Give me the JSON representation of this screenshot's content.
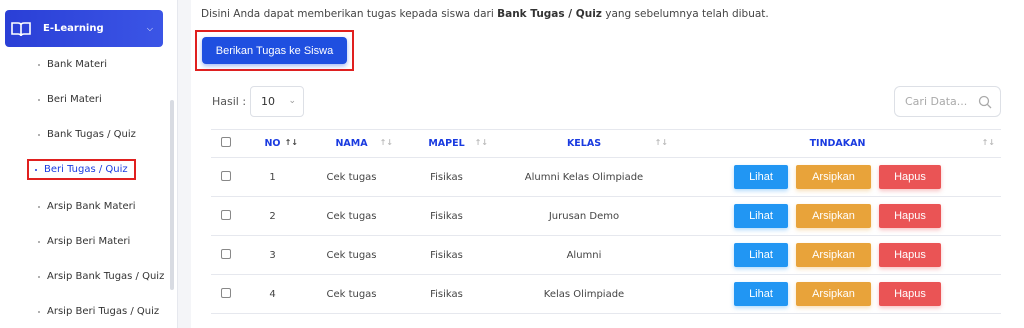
{
  "sidebar": {
    "menu": {
      "label": "E-Learning"
    },
    "items": [
      {
        "label": "Bank Materi"
      },
      {
        "label": "Beri Materi"
      },
      {
        "label": "Bank Tugas / Quiz"
      },
      {
        "label": "Beri Tugas / Quiz",
        "active": true
      },
      {
        "label": "Arsip Bank Materi"
      },
      {
        "label": "Arsip Beri Materi"
      },
      {
        "label": "Arsip Bank Tugas / Quiz"
      },
      {
        "label": "Arsip Beri Tugas / Quiz"
      }
    ]
  },
  "main": {
    "description_pre": "Disini Anda dapat memberikan tugas kepada siswa dari ",
    "description_bold": "Bank Tugas / Quiz",
    "description_post": " yang sebelumnya telah dibuat.",
    "give_button": "Berikan Tugas ke Siswa",
    "hasil_label": "Hasil :",
    "page_size": "10",
    "search_placeholder": "Cari Data..."
  },
  "table": {
    "headers": {
      "no": "NO",
      "nama": "NAMA",
      "mapel": "MAPEL",
      "kelas": "KELAS",
      "tindakan": "TINDAKAN"
    },
    "rows": [
      {
        "no": "1",
        "nama": "Cek tugas",
        "mapel": "Fisikas",
        "kelas": "Alumni Kelas Olimpiade"
      },
      {
        "no": "2",
        "nama": "Cek tugas",
        "mapel": "Fisikas",
        "kelas": "Jurusan Demo"
      },
      {
        "no": "3",
        "nama": "Cek tugas",
        "mapel": "Fisikas",
        "kelas": "Alumni"
      },
      {
        "no": "4",
        "nama": "Cek tugas",
        "mapel": "Fisikas",
        "kelas": "Kelas Olimpiade"
      }
    ],
    "actions": {
      "view": "Lihat",
      "archive": "Arsipkan",
      "delete": "Hapus"
    }
  },
  "colors": {
    "primary": "#1f4fe0",
    "view": "#2196f3",
    "archive": "#e8a33a",
    "delete": "#ea5455",
    "highlight": "#e0201f"
  }
}
